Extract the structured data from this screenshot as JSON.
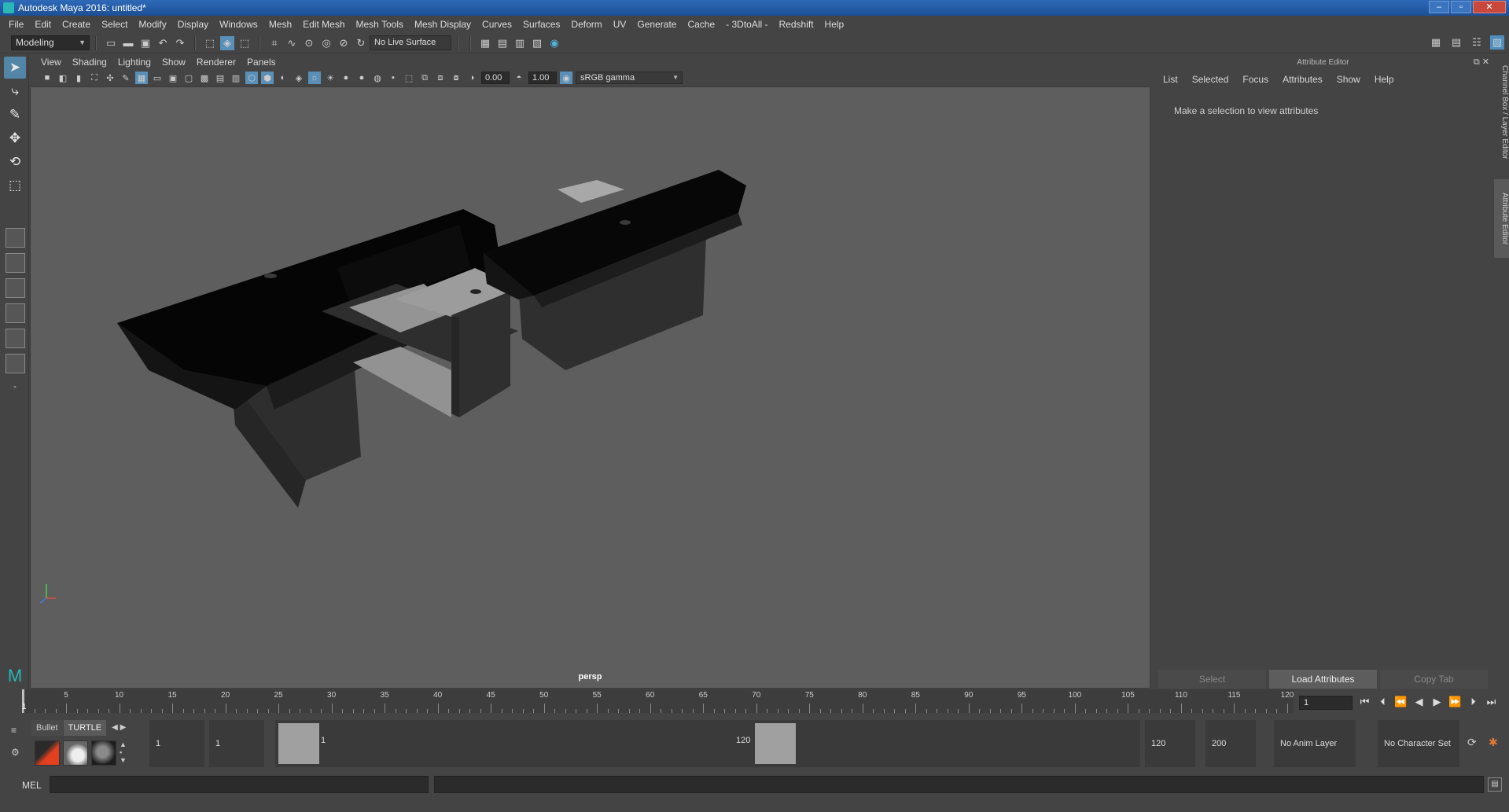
{
  "window": {
    "title": "Autodesk Maya 2016: untitled*",
    "buttons": [
      "–",
      "▫",
      "✕"
    ]
  },
  "menubar": {
    "items": [
      "File",
      "Edit",
      "Create",
      "Select",
      "Modify",
      "Display",
      "Windows",
      "Mesh",
      "Edit Mesh",
      "Mesh Tools",
      "Mesh Display",
      "Curves",
      "Surfaces",
      "Deform",
      "UV",
      "Generate",
      "Cache",
      "- 3DtoAll -",
      "Redshift",
      "Help"
    ]
  },
  "statusline": {
    "mode": "Modeling",
    "live_surface": "No Live Surface"
  },
  "viewport": {
    "menu": [
      "View",
      "Shading",
      "Lighting",
      "Show",
      "Renderer",
      "Panels"
    ],
    "exposure": "0.00",
    "gamma": "1.00",
    "color_management": "sRGB gamma",
    "camera": "persp"
  },
  "attribute_editor": {
    "title": "Attribute Editor",
    "menu": [
      "List",
      "Selected",
      "Focus",
      "Attributes",
      "Show",
      "Help"
    ],
    "hint": "Make a selection to view attributes",
    "buttons": [
      "Select",
      "Load Attributes",
      "Copy Tab"
    ]
  },
  "side_tabs": [
    "Channel Box / Layer Editor",
    "Attribute Editor"
  ],
  "timeline": {
    "ticks": [
      "5",
      "10",
      "15",
      "20",
      "25",
      "30",
      "35",
      "40",
      "45",
      "50",
      "55",
      "60",
      "65",
      "70",
      "75",
      "80",
      "85",
      "90",
      "95",
      "100",
      "105",
      "110",
      "115",
      "120"
    ],
    "current_frame_marker": "1",
    "current_frame": "1"
  },
  "range": {
    "shelf_tabs": [
      "Bullet",
      "TURTLE"
    ],
    "start": "1",
    "playback_start": "1",
    "inner_start": "1",
    "inner_end": "120",
    "playback_end": "120",
    "end": "200",
    "anim_layer": "No Anim Layer",
    "character_set": "No Character Set"
  },
  "cmdline": {
    "label": "MEL"
  }
}
